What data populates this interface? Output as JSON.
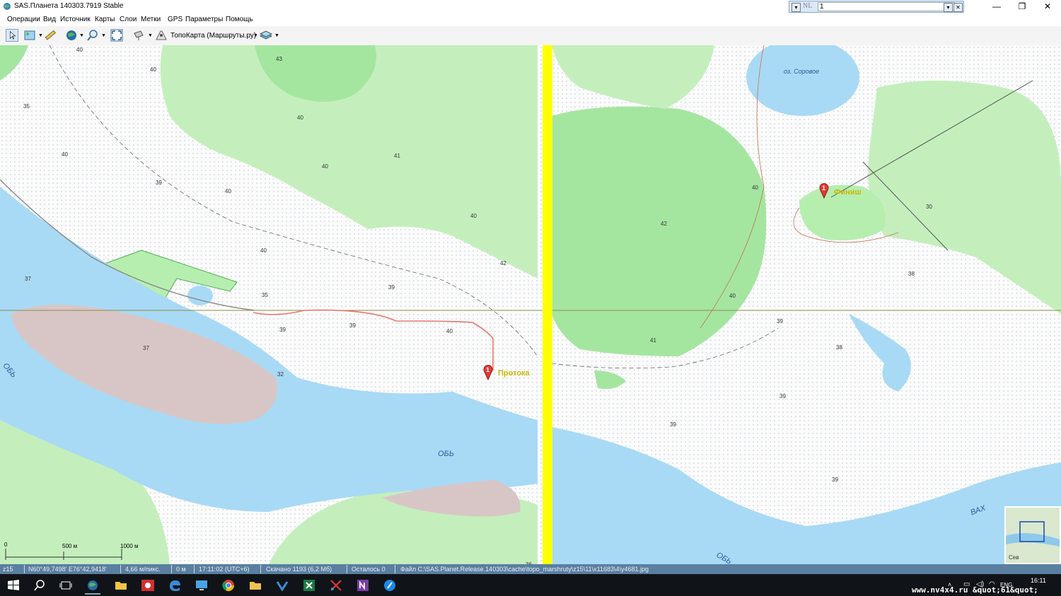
{
  "window": {
    "title": "SAS.Планета 140303.7919 Stable",
    "controls": {
      "minimize": "—",
      "restore": "❐",
      "close": "✕"
    }
  },
  "search": {
    "mode": "NL",
    "value": "1"
  },
  "menu": [
    "Операции",
    "Вид",
    "Источник",
    "Карты",
    "Слои",
    "Метки",
    "GPS",
    "Параметры",
    "Помощь"
  ],
  "toolbar": {
    "map_source": "ТопоКарта (Маршруты.ру)"
  },
  "map": {
    "water_labels": [
      "оз. Соровое",
      "ОБЬ",
      "ОБЬ",
      "ОБЬ",
      "ВАХ"
    ],
    "elevations": [
      "40",
      "40",
      "43",
      "35",
      "40",
      "40",
      "39",
      "40",
      "41",
      "40",
      "40",
      "42",
      "39",
      "40",
      "39",
      "37",
      "37",
      "35",
      "39",
      "40",
      "32",
      "40",
      "42",
      "41",
      "40",
      "39",
      "38",
      "38",
      "39",
      "39",
      "39",
      "36",
      "30"
    ],
    "markers": [
      {
        "number": "1",
        "label": "Протока"
      },
      {
        "number": "1",
        "label": "Финиш"
      }
    ],
    "scale": {
      "label_a": "500 м",
      "label_b": "1000 м",
      "zero": "0"
    },
    "minimap_label": "Сев"
  },
  "status": {
    "zoom": "z15",
    "coords": "N60°49,7498' E76°42,9418'",
    "resolution": "4,66 м/пикс.",
    "distance": "0 м",
    "time": "17:11:02 (UTC+6)",
    "downloaded": "Скачано 1193 (6,2 Мб)",
    "remaining": "Осталось 0",
    "file": "Файл C:\\SAS.Planet.Release.140303\\cache\\topo_marshruty\\z15\\11\\x11683\\4\\y4681.jpg"
  },
  "taskbar": {
    "time": "16:11",
    "lang": "ENG"
  },
  "watermark": "www.nv4x4.ru &quot;61&quot;",
  "colors": {
    "water": "#a8daf5",
    "forest": "#c4efbc",
    "forest_dark": "#a4e6a0",
    "sand": "#d8c6c6",
    "divider": "#ffff00",
    "route": "#e8786e",
    "statusbar": "#5a7fa0",
    "taskbar": "#101418"
  }
}
